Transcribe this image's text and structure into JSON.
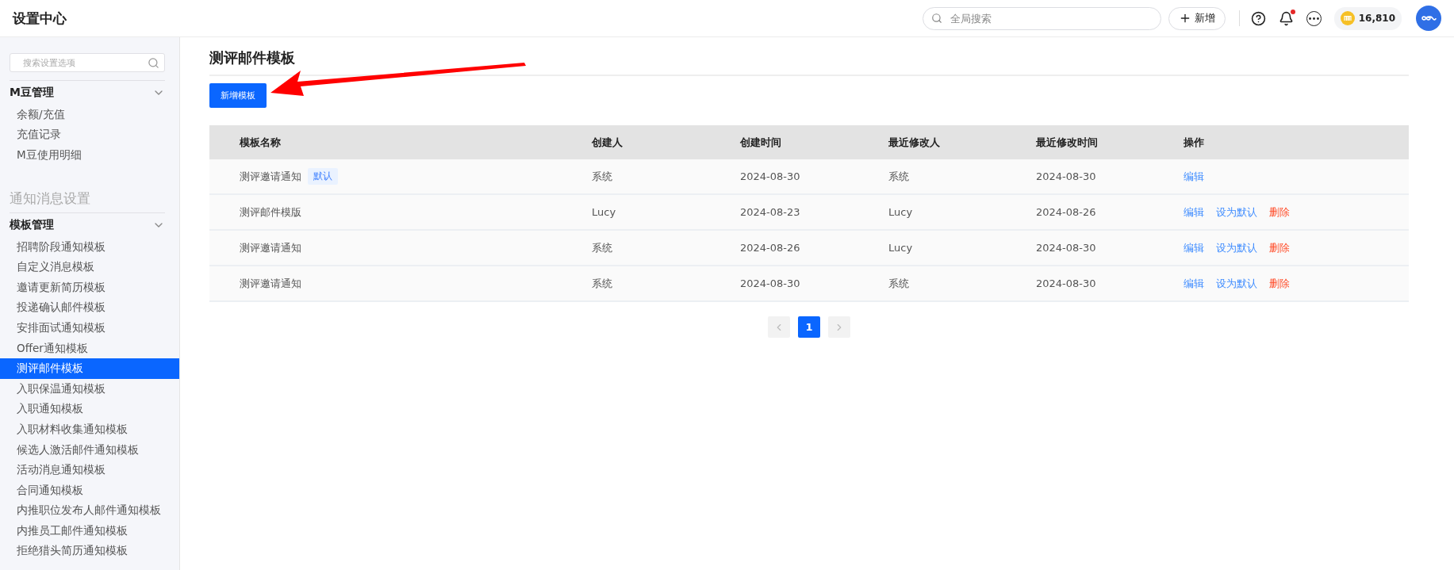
{
  "header": {
    "title": "设置中心",
    "search": {
      "placeholder": "全局搜索"
    },
    "new_button": "新增",
    "notification_unread": true,
    "coins": "16,810"
  },
  "sidebar": {
    "search": {
      "placeholder": "搜索设置选项"
    },
    "sections": [
      {
        "groups": [
          {
            "label": "M豆管理",
            "expanded": true,
            "items": [
              {
                "label": "余额/充值",
                "selected": false
              },
              {
                "label": "充值记录",
                "selected": false
              },
              {
                "label": "M豆使用明细",
                "selected": false
              }
            ]
          }
        ]
      },
      {
        "title": "通知消息设置",
        "groups": [
          {
            "label": "模板管理",
            "expanded": true,
            "items": [
              {
                "label": "招聘阶段通知模板",
                "selected": false
              },
              {
                "label": "自定义消息模板",
                "selected": false
              },
              {
                "label": "邀请更新简历模板",
                "selected": false
              },
              {
                "label": "投递确认邮件模板",
                "selected": false
              },
              {
                "label": "安排面试通知模板",
                "selected": false
              },
              {
                "label": "Offer通知模板",
                "selected": false
              },
              {
                "label": "测评邮件模板",
                "selected": true
              },
              {
                "label": "入职保温通知模板",
                "selected": false
              },
              {
                "label": "入职通知模板",
                "selected": false
              },
              {
                "label": "入职材料收集通知模板",
                "selected": false
              },
              {
                "label": "候选人激活邮件通知模板",
                "selected": false
              },
              {
                "label": "活动消息通知模板",
                "selected": false
              },
              {
                "label": "合同通知模板",
                "selected": false
              },
              {
                "label": "内推职位发布人邮件通知模板",
                "selected": false
              },
              {
                "label": "内推员工邮件通知模板",
                "selected": false
              },
              {
                "label": "拒绝猎头简历通知模板",
                "selected": false
              }
            ]
          }
        ]
      }
    ]
  },
  "main": {
    "title": "测评邮件模板",
    "add_button": "新增模板",
    "table": {
      "columns": [
        "模板名称",
        "创建人",
        "创建时间",
        "最近修改人",
        "最近修改时间",
        "操作"
      ],
      "rows": [
        {
          "name": "测评邀请通知",
          "tag": "默认",
          "creator": "系统",
          "created": "2024-08-30",
          "modifier": "系统",
          "modified": "2024-08-30",
          "actions": [
            {
              "label": "编辑",
              "kind": "link"
            }
          ]
        },
        {
          "name": "测评邮件模版",
          "creator": "Lucy",
          "created": "2024-08-23",
          "modifier": "Lucy",
          "modified": "2024-08-26",
          "actions": [
            {
              "label": "编辑",
              "kind": "link"
            },
            {
              "label": "设为默认",
              "kind": "link"
            },
            {
              "label": "删除",
              "kind": "danger"
            }
          ]
        },
        {
          "name": "测评邀请通知",
          "creator": "系统",
          "created": "2024-08-26",
          "modifier": "Lucy",
          "modified": "2024-08-30",
          "actions": [
            {
              "label": "编辑",
              "kind": "link"
            },
            {
              "label": "设为默认",
              "kind": "link"
            },
            {
              "label": "删除",
              "kind": "danger"
            }
          ]
        },
        {
          "name": "测评邀请通知",
          "creator": "系统",
          "created": "2024-08-30",
          "modifier": "系统",
          "modified": "2024-08-30",
          "actions": [
            {
              "label": "编辑",
              "kind": "link"
            },
            {
              "label": "设为默认",
              "kind": "link"
            },
            {
              "label": "删除",
              "kind": "danger"
            }
          ]
        }
      ]
    },
    "pagination": {
      "pages": [
        {
          "label": "1",
          "selected": true
        }
      ]
    }
  }
}
